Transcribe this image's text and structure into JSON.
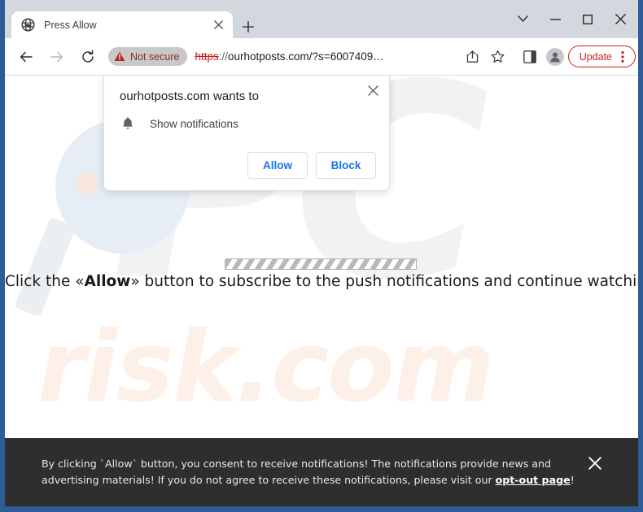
{
  "window": {
    "controls": {
      "tab_search": "tab-search-chevron",
      "minimize": "minimize",
      "maximize": "maximize",
      "close": "close"
    }
  },
  "tabstrip": {
    "tabs": [
      {
        "title": "Press Allow",
        "favicon": "globe-icon",
        "close_label": "Close tab"
      }
    ],
    "new_tab_label": "New tab"
  },
  "toolbar": {
    "back_label": "Back",
    "forward_label": "Forward",
    "reload_label": "Reload",
    "security_badge": "Not secure",
    "url": {
      "scheme": "https",
      "separator": "://",
      "rest": "ourhotposts.com/?s=6007409…",
      "full": "https://ourhotposts.com/?s=6007409…"
    },
    "share_label": "Share this page",
    "bookmark_label": "Bookmark this tab",
    "sidepanel_label": "Side panel",
    "profile_label": "Profile",
    "update_label": "Update",
    "menu_label": "Customize and control Google Chrome"
  },
  "permission_dialog": {
    "title": "ourhotposts.com wants to",
    "permission": "Show notifications",
    "permission_icon": "bell-icon",
    "allow_label": "Allow",
    "block_label": "Block",
    "close_label": "Close"
  },
  "page": {
    "message_prefix": "Click the «",
    "message_emphasis": "Allow",
    "message_suffix": "» button to subscribe to the push notifications and continue watching",
    "progress_label": "loading-progress-bar",
    "watermarks": {
      "logo": "PC",
      "domain": "risk.com"
    }
  },
  "consent_banner": {
    "text_part1": "By clicking `Allow` button, you consent to receive notifications! The notifications provide news and advertising materials! If you do not agree to receive these notifications, please visit our ",
    "link_label": "opt-out page",
    "text_part2": "!",
    "close_label": "Close banner"
  },
  "colors": {
    "frame": "#2d5c96",
    "chrome_top": "#d3d8de",
    "not_secure_text": "#8a2c24",
    "url_strike": "#c5221f",
    "update_accent": "#c5221f",
    "dialog_button_text": "#1a73e8",
    "banner_bg": "#2e2e2e",
    "watermark_logo": "#f1f2f4",
    "watermark_domain": "#fdf0e9"
  }
}
